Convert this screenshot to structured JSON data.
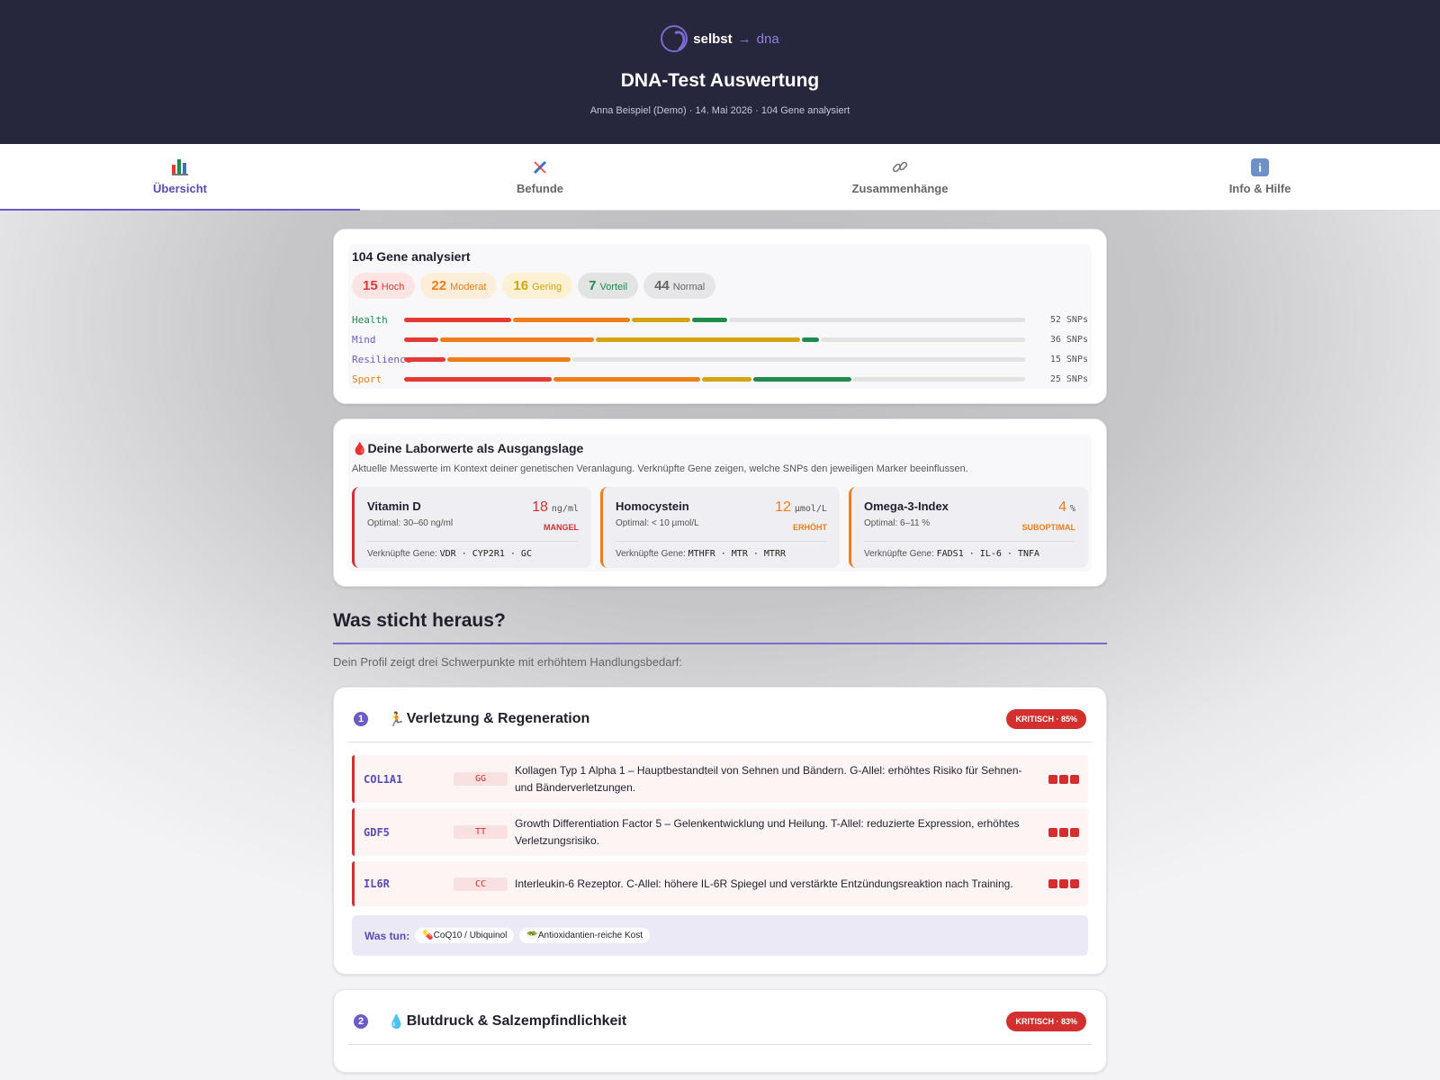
{
  "header": {
    "logo_word1": "selbst",
    "logo_arrow": "→",
    "logo_word2": "dna",
    "title": "DNA-Test Auswertung",
    "subtitle": "Anna Beispiel (Demo) · 14. Mai 2026 · 104 Gene analysiert"
  },
  "tabs": [
    {
      "label": "Übersicht",
      "icon": "bar-chart-icon",
      "active": true
    },
    {
      "label": "Befunde",
      "icon": "dna-icon"
    },
    {
      "label": "Zusammenhänge",
      "icon": "link-icon"
    },
    {
      "label": "Info & Hilfe",
      "icon": "info-icon"
    }
  ],
  "overview": {
    "title": "104 Gene analysiert",
    "pills": [
      {
        "count": "15",
        "label": "Hoch",
        "color": "#e53935",
        "bg": "#fde4e4"
      },
      {
        "count": "22",
        "label": "Moderat",
        "color": "#ef7d1a",
        "bg": "#fdeed9"
      },
      {
        "count": "16",
        "label": "Gering",
        "color": "#d4a412",
        "bg": "#fcf1d2"
      },
      {
        "count": "7",
        "label": "Vorteil",
        "color": "#1e8a4c",
        "bg": "#e1e4e2"
      },
      {
        "count": "44",
        "label": "Normal",
        "color": "#666666",
        "bg": "#e6e6e8"
      }
    ],
    "categories": [
      {
        "name": "Health",
        "color": "#1e8a4c",
        "snps": "52 SNPs",
        "segments": [
          {
            "v": 0.175,
            "c": "#e53935"
          },
          {
            "v": 0.19,
            "c": "#ef7d1a"
          },
          {
            "v": 0.095,
            "c": "#d4a412"
          },
          {
            "v": 0.058,
            "c": "#1e8a4c"
          },
          {
            "v": 0.482,
            "c": "#e2e2e2"
          }
        ]
      },
      {
        "name": "Mind",
        "color": "#6a5bc6",
        "snps": "36 SNPs",
        "segments": [
          {
            "v": 0.056,
            "c": "#e53935"
          },
          {
            "v": 0.25,
            "c": "#ef7d1a"
          },
          {
            "v": 0.333,
            "c": "#d4a412"
          },
          {
            "v": 0.028,
            "c": "#1e8a4c"
          },
          {
            "v": 0.333,
            "c": "#e2e2e2"
          }
        ]
      },
      {
        "name": "Resilience",
        "color": "#6a5bc6",
        "snps": "15 SNPs",
        "segments": [
          {
            "v": 0.067,
            "c": "#e53935"
          },
          {
            "v": 0.2,
            "c": "#ef7d1a"
          },
          {
            "v": 0.733,
            "c": "#e2e2e2"
          }
        ]
      },
      {
        "name": "Sport",
        "color": "#ef7d1a",
        "snps": "25 SNPs",
        "segments": [
          {
            "v": 0.24,
            "c": "#e53935"
          },
          {
            "v": 0.24,
            "c": "#ef7d1a"
          },
          {
            "v": 0.08,
            "c": "#d4a412"
          },
          {
            "v": 0.16,
            "c": "#1e8a4c"
          },
          {
            "v": 0.28,
            "c": "#e2e2e2"
          }
        ]
      }
    ]
  },
  "lab": {
    "icon": "🩸",
    "title": "Deine Laborwerte als Ausgangslage",
    "description": "Aktuelle Messwerte im Kontext deiner genetischen Veranlagung. Verknüpfte Gene zeigen, welche SNPs den jeweiligen Marker beeinflussen.",
    "genes_label": "Verknüpfte Gene:",
    "items": [
      {
        "name": "Vitamin D",
        "optimal": "Optimal: 30–60 ng/ml",
        "value": "18",
        "unit": "ng/ml",
        "status": "MANGEL",
        "color": "#d32f2f",
        "genes": "VDR · CYP2R1 · GC"
      },
      {
        "name": "Homocystein",
        "optimal": "Optimal: < 10 µmol/L",
        "value": "12",
        "unit": "µmol/L",
        "status": "ERHÖHT",
        "color": "#ef7d1a",
        "genes": "MTHFR · MTR · MTRR"
      },
      {
        "name": "Omega-3-Index",
        "optimal": "Optimal: 6–11 %",
        "value": "4",
        "unit": "%",
        "status": "SUBOPTIMAL",
        "color": "#ef7d1a",
        "genes": "FADS1 · IL-6 · TNFA"
      }
    ]
  },
  "highlights": {
    "title": "Was sticht heraus?",
    "subtitle": "Dein Profil zeigt drei Schwerpunkte mit erhöhtem Handlungsbedarf:",
    "todo_label": "Was tun:",
    "items": [
      {
        "number": "1",
        "emoji": "🏃",
        "title": "Verletzung & Regeneration",
        "badge": "KRITISCH · 85%",
        "genes": [
          {
            "gene": "COL1A1",
            "genotype": "GG",
            "text": "Kollagen Typ 1 Alpha 1 – Hauptbestandteil von Sehnen und Bändern. G-Allel: erhöhtes Risiko für Sehnen- und Bänderverletzungen."
          },
          {
            "gene": "GDF5",
            "genotype": "TT",
            "text": "Growth Differentiation Factor 5 – Gelenkentwicklung und Heilung. T-Allel: reduzierte Expression, erhöhtes Verletzungsrisiko."
          },
          {
            "gene": "IL6R",
            "genotype": "CC",
            "text": "Interleukin-6 Rezeptor. C-Allel: höhere IL-6R Spiegel und verstärkte Entzündungsreaktion nach Training."
          }
        ],
        "todo": [
          {
            "icon": "💊",
            "label": "CoQ10 / Ubiquinol"
          },
          {
            "icon": "🥗",
            "label": "Antioxidantien-reiche Kost"
          }
        ]
      },
      {
        "number": "2",
        "emoji": "💧",
        "title": "Blutdruck & Salzempfindlichkeit",
        "badge": "KRITISCH · 83%"
      }
    ]
  }
}
